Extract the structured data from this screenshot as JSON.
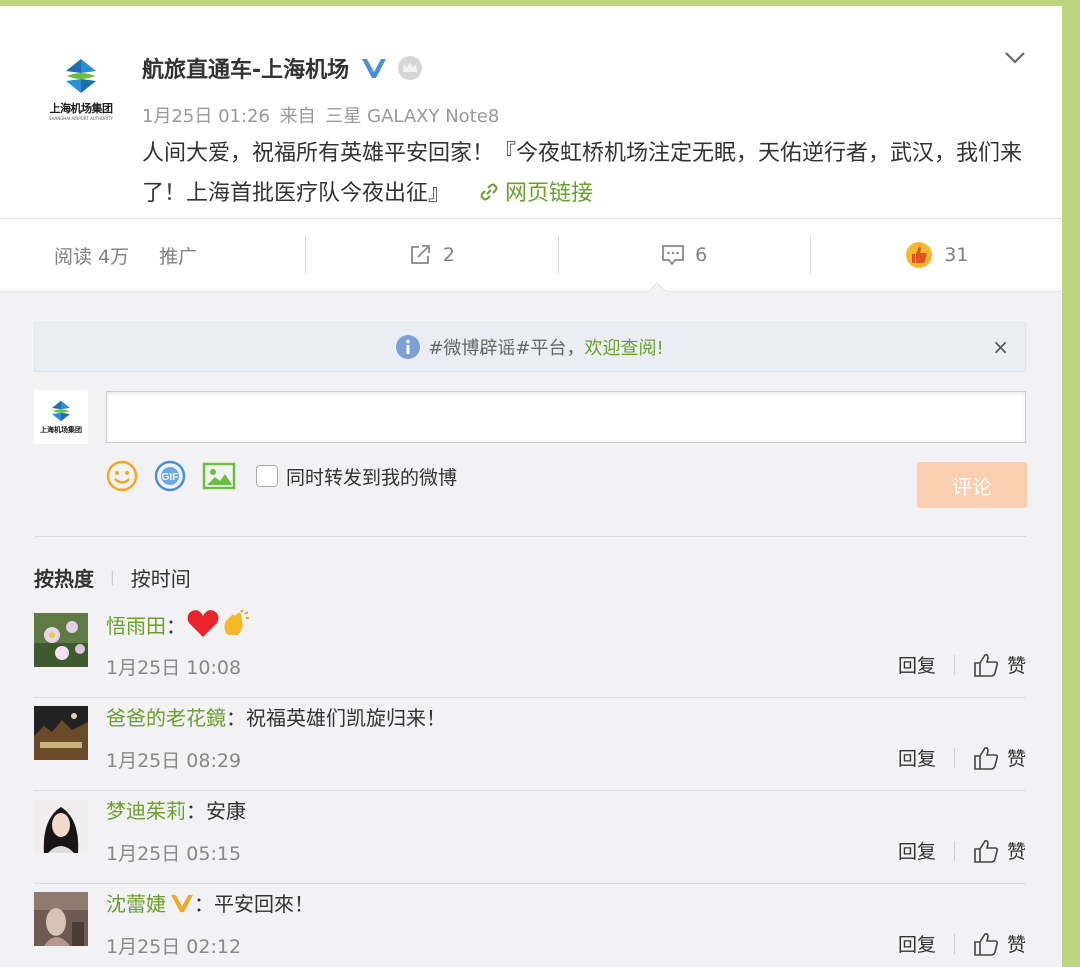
{
  "post": {
    "author": "航旅直通车-上海机场",
    "logo_text": "上海机场集团",
    "logo_sub": "SHANGHAI AIRPORT AUTHORITY",
    "time": "1月25日 01:26",
    "from_label": "来自",
    "device": "三星 GALAXY Note8",
    "text": "人间大爱，祝福所有英雄平安回家！『今夜虹桥机场注定无眠，天佑逆行者，武汉，我们来了！上海首批医疗队今夜出征』",
    "link_label": "网页链接"
  },
  "actions": {
    "reads": "阅读 4万",
    "promote": "推广",
    "reposts": "2",
    "comments": "6",
    "likes": "31"
  },
  "notice": {
    "text": "#微博辟谣#平台，",
    "link": "欢迎查阅!",
    "close": "×"
  },
  "compose": {
    "avatar_text": "上海机场集团",
    "repost_label": "同时转发到我的微博",
    "submit_label": "评论"
  },
  "sort": {
    "hot": "按热度",
    "time": "按时间"
  },
  "comments": [
    {
      "user": "悟雨田",
      "text": "",
      "time": "1月25日 10:08",
      "reply": "回复",
      "like": "赞"
    },
    {
      "user": "爸爸的老花鏡",
      "text": "祝福英雄们凯旋归来！",
      "time": "1月25日 08:29",
      "reply": "回复",
      "like": "赞"
    },
    {
      "user": "梦迪茱莉",
      "text": "安康",
      "time": "1月25日 05:15",
      "reply": "回复",
      "like": "赞"
    },
    {
      "user": "沈蕾婕",
      "text": "平安回來！",
      "time": "1月25日 02:12",
      "reply": "回复",
      "like": "赞"
    }
  ],
  "colors": {
    "accent_green": "#6b9f2e",
    "verified_blue": "#4a90d9",
    "verified_orange": "#f5a623",
    "submit_disabled": "#fbcdb1"
  }
}
